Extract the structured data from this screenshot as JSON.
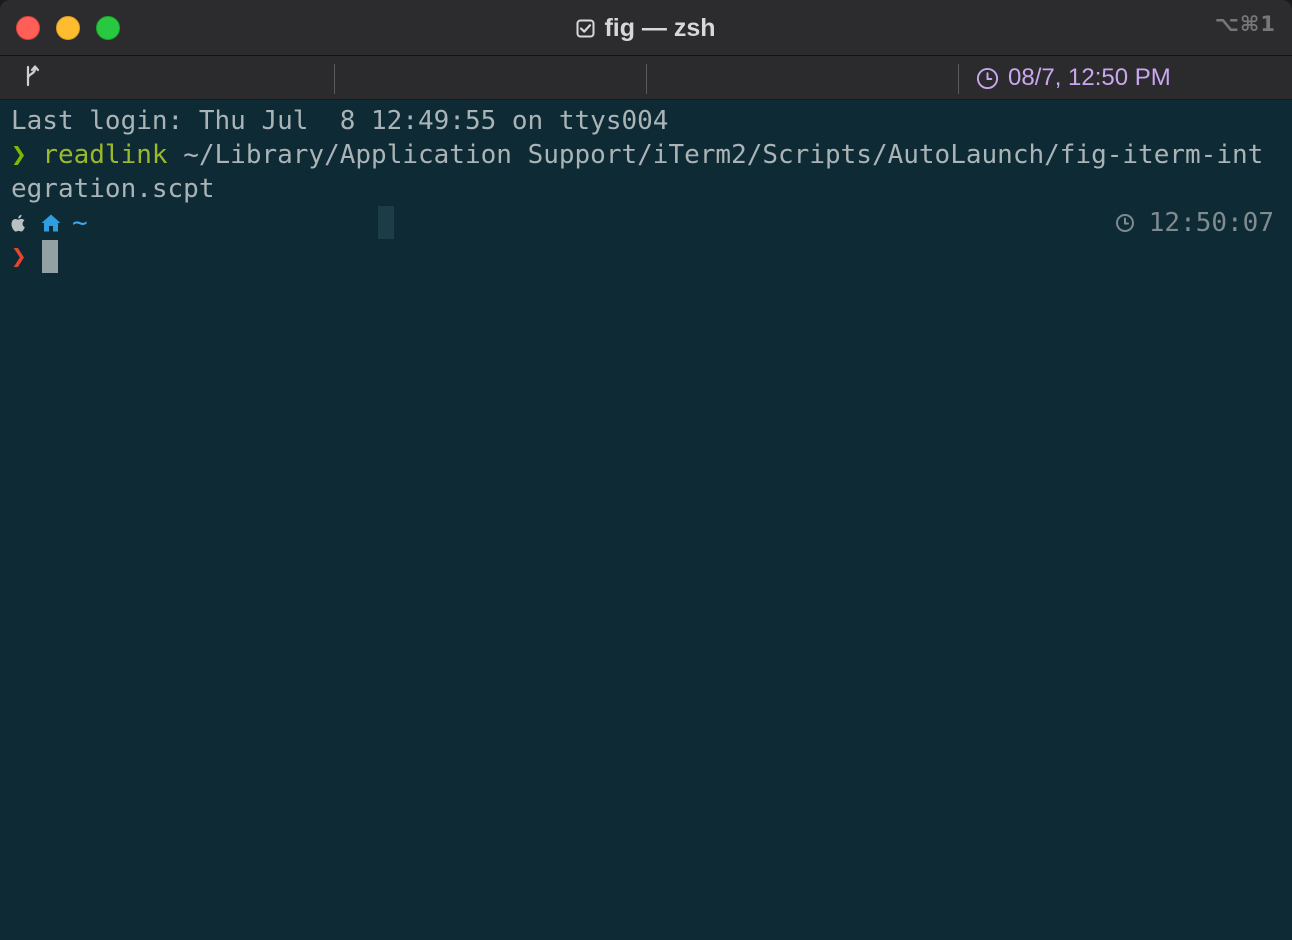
{
  "window": {
    "title": "fig — zsh",
    "title_icon": "checkbox-icon",
    "shortcut": "⌥⌘1"
  },
  "statusbar": {
    "branch_icon": "git-branch-icon",
    "time_icon": "clock-icon",
    "time_text": "08/7, 12:50 PM"
  },
  "terminal": {
    "last_login": "Last login: Thu Jul  8 12:49:55 on ttys004",
    "prompt_symbol": "❯",
    "command": "readlink",
    "command_args_line1": " ~/Library/Application Support/iTerm2/Scripts/AutoLaunch/fig-iterm-int",
    "command_args_line2": "egration.scpt",
    "segment_apple_icon": "apple-icon",
    "segment_home_icon": "home-icon",
    "cwd": "~",
    "right_prompt_icon": "clock-icon",
    "right_prompt_time": "12:50:07",
    "active_prompt_symbol": "❯"
  },
  "colors": {
    "terminal_bg": "#0e2a35",
    "prompt_ok": "#7fb800",
    "prompt_active": "#e8442f",
    "status_time": "#c9a6f0",
    "cwd_blue": "#3aa9f0"
  }
}
